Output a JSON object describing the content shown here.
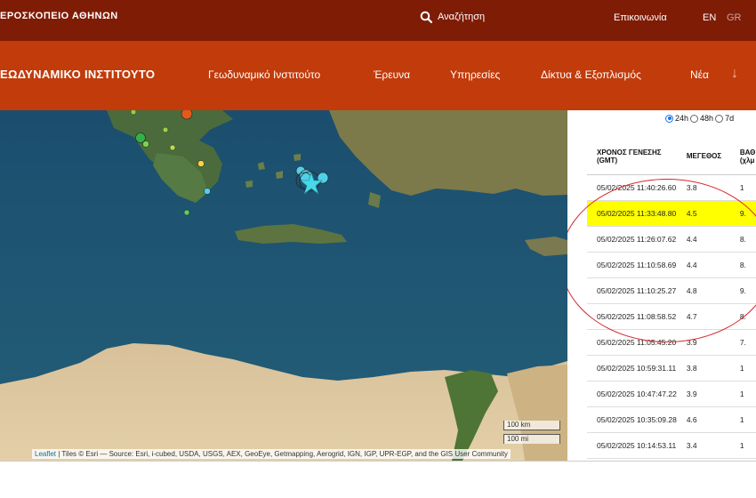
{
  "header": {
    "brand": "ΕΡΟΣΚΟΠΕΙΟ ΑΘΗΝΩΝ",
    "search_label": "Αναζήτηση",
    "contact_label": "Επικοινωνία",
    "lang_en": "EN",
    "lang_gr": "GR",
    "search_icon": "search-icon"
  },
  "nav": {
    "institute": "ΕΩΔΥΝΑΜΙΚΟ ΙΝΣΤΙΤΟΥΤΟ",
    "items": [
      "Γεωδυναμικό Ινστιτούτο",
      "Έρευνα",
      "Υπηρεσίες",
      "Δίκτυα & Εξοπλισμός",
      "Νέα"
    ],
    "arrow_icon": "arrow-down-icon"
  },
  "map": {
    "attribution_link": "Leaflet",
    "attribution_text": "| Tiles © Esri — Source: Esri, i-cubed, USDA, USGS, AEX, GeoEye, Getmapping, Aerogrid, IGN, IGP, UPR-EGP, and the GIS User Community",
    "scale_km": "100 km",
    "scale_mi": "100 mi"
  },
  "panel": {
    "radios": [
      {
        "label": "24h",
        "checked": true
      },
      {
        "label": "48h",
        "checked": false
      },
      {
        "label": "7d",
        "checked": false
      }
    ],
    "headers": [
      "ΧΡΟΝΟΣ ΓΕΝΕΣΗΣ (GMT)",
      "ΜΕΓΕΘΟΣ",
      "ΒΑΘ (χλμ"
    ],
    "rows": [
      {
        "time": "05/02/2025 11:40:26.60",
        "mag": "3.8",
        "depth": "1",
        "highlight": false
      },
      {
        "time": "05/02/2025 11:33:48.80",
        "mag": "4.5",
        "depth": "9.",
        "highlight": true
      },
      {
        "time": "05/02/2025 11:26:07.62",
        "mag": "4.4",
        "depth": "8.",
        "highlight": false
      },
      {
        "time": "05/02/2025 11:10:58.69",
        "mag": "4.4",
        "depth": "8.",
        "highlight": false
      },
      {
        "time": "05/02/2025 11:10:25.27",
        "mag": "4.8",
        "depth": "9.",
        "highlight": false
      },
      {
        "time": "05/02/2025 11:08:58.52",
        "mag": "4.7",
        "depth": "8.",
        "highlight": false
      },
      {
        "time": "05/02/2025 11:05:45.20",
        "mag": "3.9",
        "depth": "7.",
        "highlight": false
      },
      {
        "time": "05/02/2025 10:59:31.11",
        "mag": "3.8",
        "depth": "1",
        "highlight": false
      },
      {
        "time": "05/02/2025 10:47:47.22",
        "mag": "3.9",
        "depth": "1",
        "highlight": false
      },
      {
        "time": "05/02/2025 10:35:09.28",
        "mag": "4.6",
        "depth": "1",
        "highlight": false
      },
      {
        "time": "05/02/2025 10:14:53.11",
        "mag": "3.4",
        "depth": "1",
        "highlight": false
      }
    ]
  },
  "colors": {
    "topbar": "#7f1c06",
    "navbar": "#c13b0b",
    "highlight": "#ffff00",
    "annotation": "#d8282d",
    "quake_marker": "#4fd1e8"
  }
}
